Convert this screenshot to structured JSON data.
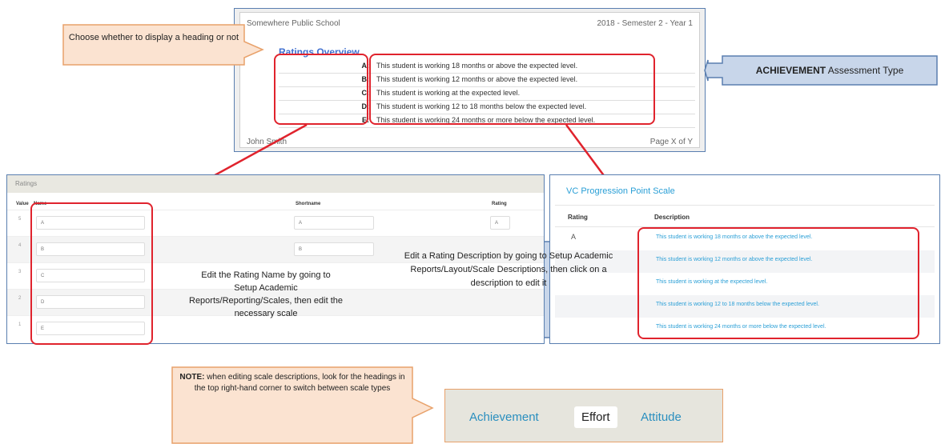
{
  "report_preview": {
    "school": "Somewhere Public School",
    "term": "2018 - Semester 2 - Year 1",
    "heading": "Ratings Overview",
    "rows": [
      {
        "grade": "A:",
        "description": "This student is working 18 months or above the expected level."
      },
      {
        "grade": "B:",
        "description": "This student is working 12 months or above the expected level."
      },
      {
        "grade": "C:",
        "description": "This student is working at the expected level."
      },
      {
        "grade": "D:",
        "description": "This student is working 12 to 18 months below the expected level."
      },
      {
        "grade": "E:",
        "description": "This student is working 24 months or more below the expected level."
      }
    ],
    "footer_name": "John Smith",
    "footer_page": "Page X of Y"
  },
  "callouts": {
    "heading": "Choose whether to display a heading or not",
    "assessment_bold": "ACHIEVEMENT",
    "assessment_rest": " Assessment Type",
    "rating_name": "Edit the Rating Name by going to Setup Academic Reports/Reporting/Scales, then edit the necessary scale",
    "rating_desc": "Edit a Rating Description by going to Setup Academic Reports/Layout/Scale Descriptions, then click on a description to edit it",
    "note_bold": "NOTE:",
    "note_rest": " when editing scale descriptions, look for the headings in the top right-hand corner to switch between scale types"
  },
  "ratings_panel": {
    "title": "Ratings",
    "headers": {
      "value": "Value",
      "name": "Name",
      "shortname": "Shortname",
      "rating": "Rating"
    },
    "rows": [
      {
        "value": "5",
        "name": "A",
        "shortname": "A",
        "rating": "A"
      },
      {
        "value": "4",
        "name": "B",
        "shortname": "B",
        "rating": ""
      },
      {
        "value": "3",
        "name": "C",
        "shortname": "",
        "rating": ""
      },
      {
        "value": "2",
        "name": "D",
        "shortname": "",
        "rating": ""
      },
      {
        "value": "1",
        "name": "E",
        "shortname": "",
        "rating": ""
      }
    ]
  },
  "vc_panel": {
    "title": "VC Progression Point Scale",
    "headers": {
      "rating": "Rating",
      "description": "Description"
    },
    "rows": [
      {
        "grade": "A",
        "description": "This student is working 18 months or above the expected level."
      },
      {
        "grade": "",
        "description": "This student is working 12 months or above the expected level."
      },
      {
        "grade": "",
        "description": "This student is working at the expected level."
      },
      {
        "grade": "",
        "description": "This student is working 12 to 18 months below the expected level."
      },
      {
        "grade": "",
        "description": "This student is working 24 months or more below the expected level."
      }
    ]
  },
  "tabs": [
    "Achievement",
    "Effort",
    "Attitude"
  ],
  "active_tab": "Effort",
  "colors": {
    "callout_orange": "#fbe3d1",
    "callout_blue": "#c8d6ea",
    "highlight_red": "#e0232d",
    "link_blue": "#2a9fd6"
  }
}
